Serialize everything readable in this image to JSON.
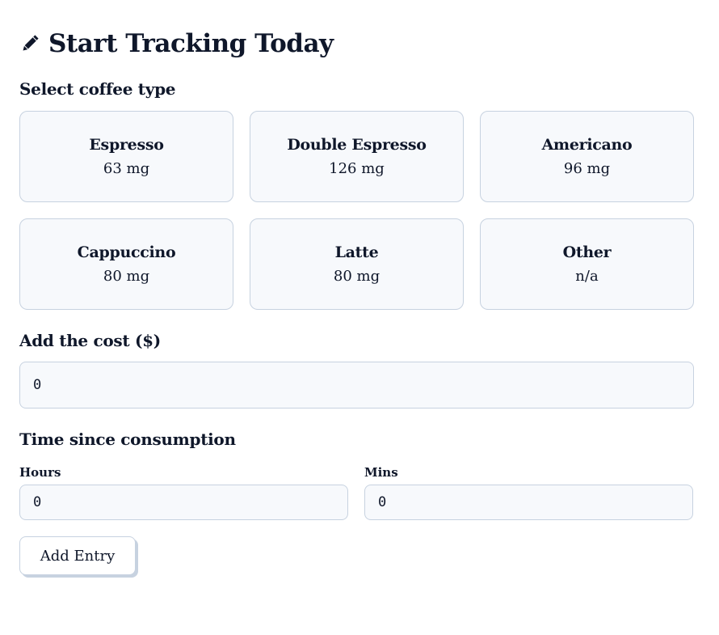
{
  "header": {
    "icon": "pencil-icon",
    "title": "Start Tracking Today"
  },
  "coffee": {
    "label": "Select coffee type",
    "options": [
      {
        "name": "Espresso",
        "caffeine": "63 mg"
      },
      {
        "name": "Double Espresso",
        "caffeine": "126 mg"
      },
      {
        "name": "Americano",
        "caffeine": "96 mg"
      },
      {
        "name": "Cappuccino",
        "caffeine": "80 mg"
      },
      {
        "name": "Latte",
        "caffeine": "80 mg"
      },
      {
        "name": "Other",
        "caffeine": "n/a"
      }
    ]
  },
  "cost": {
    "label": "Add the cost ($)",
    "value": "0"
  },
  "time": {
    "label": "Time since consumption",
    "hours_label": "Hours",
    "hours_value": "0",
    "mins_label": "Mins",
    "mins_value": "0"
  },
  "submit_label": "Add Entry",
  "colors": {
    "text": "#0f172a",
    "card_bg": "#f7f9fc",
    "border": "#c7d2e0"
  }
}
